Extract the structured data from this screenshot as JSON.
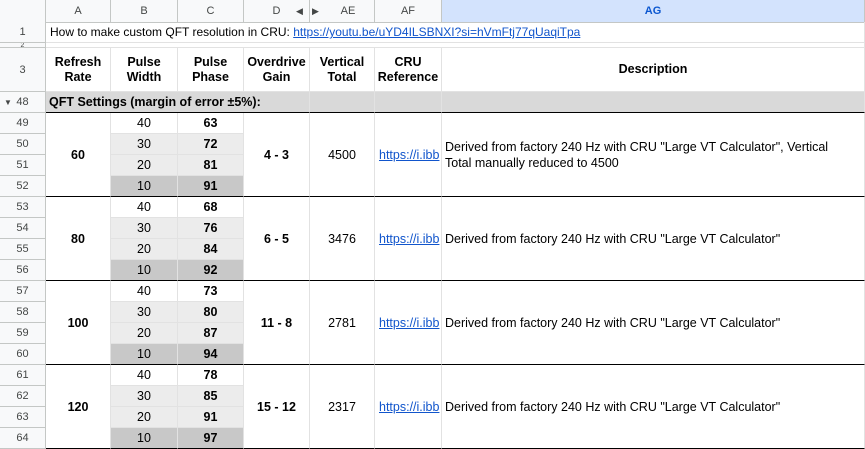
{
  "columns": [
    "A",
    "B",
    "C",
    "D",
    "AE",
    "AF",
    "AG"
  ],
  "rows_top": [
    "1",
    "2",
    "3"
  ],
  "title_text": "How to make custom QFT resolution in CRU: ",
  "title_link": "https://youtu.be/uYD4ILSBNXI?si=hVmFtj77qUaqiTpa",
  "headers": {
    "refresh": "Refresh\nRate",
    "pulse_width": "Pulse\nWidth",
    "pulse_phase": "Pulse\nPhase",
    "overdrive": "Overdrive\nGain",
    "vertical": "Vertical\nTotal",
    "cru": "CRU\nReference",
    "description": "Description"
  },
  "section_row": "48",
  "section_label": "QFT Settings (margin of error ±5%):",
  "groups": [
    {
      "rows": [
        "49",
        "50",
        "51",
        "52"
      ],
      "refresh": "60",
      "widths": [
        "40",
        "30",
        "20",
        "10"
      ],
      "phases": [
        "63",
        "72",
        "81",
        "91"
      ],
      "overdrive": "4 - 3",
      "vertical": "4500",
      "cru": "https://i.ibb",
      "description": "Derived from factory 240 Hz with CRU \"Large VT Calculator\", Vertical Total manually reduced to 4500"
    },
    {
      "rows": [
        "53",
        "54",
        "55",
        "56"
      ],
      "refresh": "80",
      "widths": [
        "40",
        "30",
        "20",
        "10"
      ],
      "phases": [
        "68",
        "76",
        "84",
        "92"
      ],
      "overdrive": "6 - 5",
      "vertical": "3476",
      "cru": "https://i.ibb",
      "description": "Derived from factory 240 Hz with CRU \"Large VT Calculator\""
    },
    {
      "rows": [
        "57",
        "58",
        "59",
        "60"
      ],
      "refresh": "100",
      "widths": [
        "40",
        "30",
        "20",
        "10"
      ],
      "phases": [
        "73",
        "80",
        "87",
        "94"
      ],
      "overdrive": "11 - 8",
      "vertical": "2781",
      "cru": "https://i.ibb",
      "description": "Derived from factory 240 Hz with CRU \"Large VT Calculator\""
    },
    {
      "rows": [
        "61",
        "62",
        "63",
        "64"
      ],
      "refresh": "120",
      "widths": [
        "40",
        "30",
        "20",
        "10"
      ],
      "phases": [
        "78",
        "85",
        "91",
        "97"
      ],
      "overdrive": "15 - 12",
      "vertical": "2317",
      "cru": "https://i.ibb",
      "description": "Derived from factory 240 Hz with CRU \"Large VT Calculator\""
    }
  ]
}
